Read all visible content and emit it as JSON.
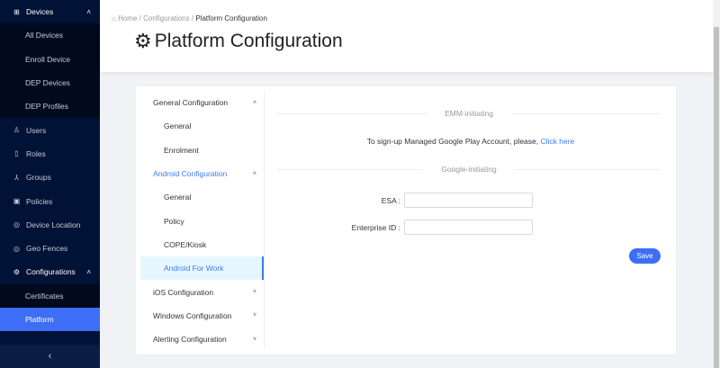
{
  "sidebar": {
    "devices": {
      "label": "Devices",
      "children": [
        "All Devices",
        "Enroll Device",
        "DEP Devices",
        "DEP Profiles"
      ]
    },
    "items": [
      {
        "label": "Users",
        "icon": "user-icon"
      },
      {
        "label": "Roles",
        "icon": "book-icon"
      },
      {
        "label": "Groups",
        "icon": "groups-icon"
      },
      {
        "label": "Policies",
        "icon": "policy-icon"
      },
      {
        "label": "Device Location",
        "icon": "location-icon"
      },
      {
        "label": "Geo Fences",
        "icon": "location-icon"
      }
    ],
    "configurations": {
      "label": "Configurations",
      "children": [
        "Certificates",
        "Platform"
      ],
      "active": "Platform"
    },
    "collapse": "‹"
  },
  "header": {
    "breadcrumb": [
      "Home",
      "Configurations",
      "Platform Configuration"
    ],
    "title": "Platform Configuration"
  },
  "menu": {
    "general": {
      "label": "General Configuration",
      "children": [
        "General",
        "Enrolment"
      ]
    },
    "android": {
      "label": "Android Configuration",
      "children": [
        "General",
        "Policy",
        "COPE/Kiosk",
        "Android For Work"
      ],
      "selected": "Android For Work"
    },
    "others": [
      "iOS Configuration",
      "Windows Configuration",
      "Alerting Configuration"
    ]
  },
  "content": {
    "emm_divider": "EMM-initiating",
    "signup_text": "To sign-up Managed Google Play Account, please,",
    "signup_link": "Click here",
    "google_divider": "Google-initiating",
    "esa_label": "ESA :",
    "esa_value": "",
    "enterprise_label": "Enterprise ID :",
    "enterprise_value": "",
    "save": "Save"
  },
  "colors": {
    "accent": "#3d6ef5",
    "sidebar": "#001235"
  }
}
